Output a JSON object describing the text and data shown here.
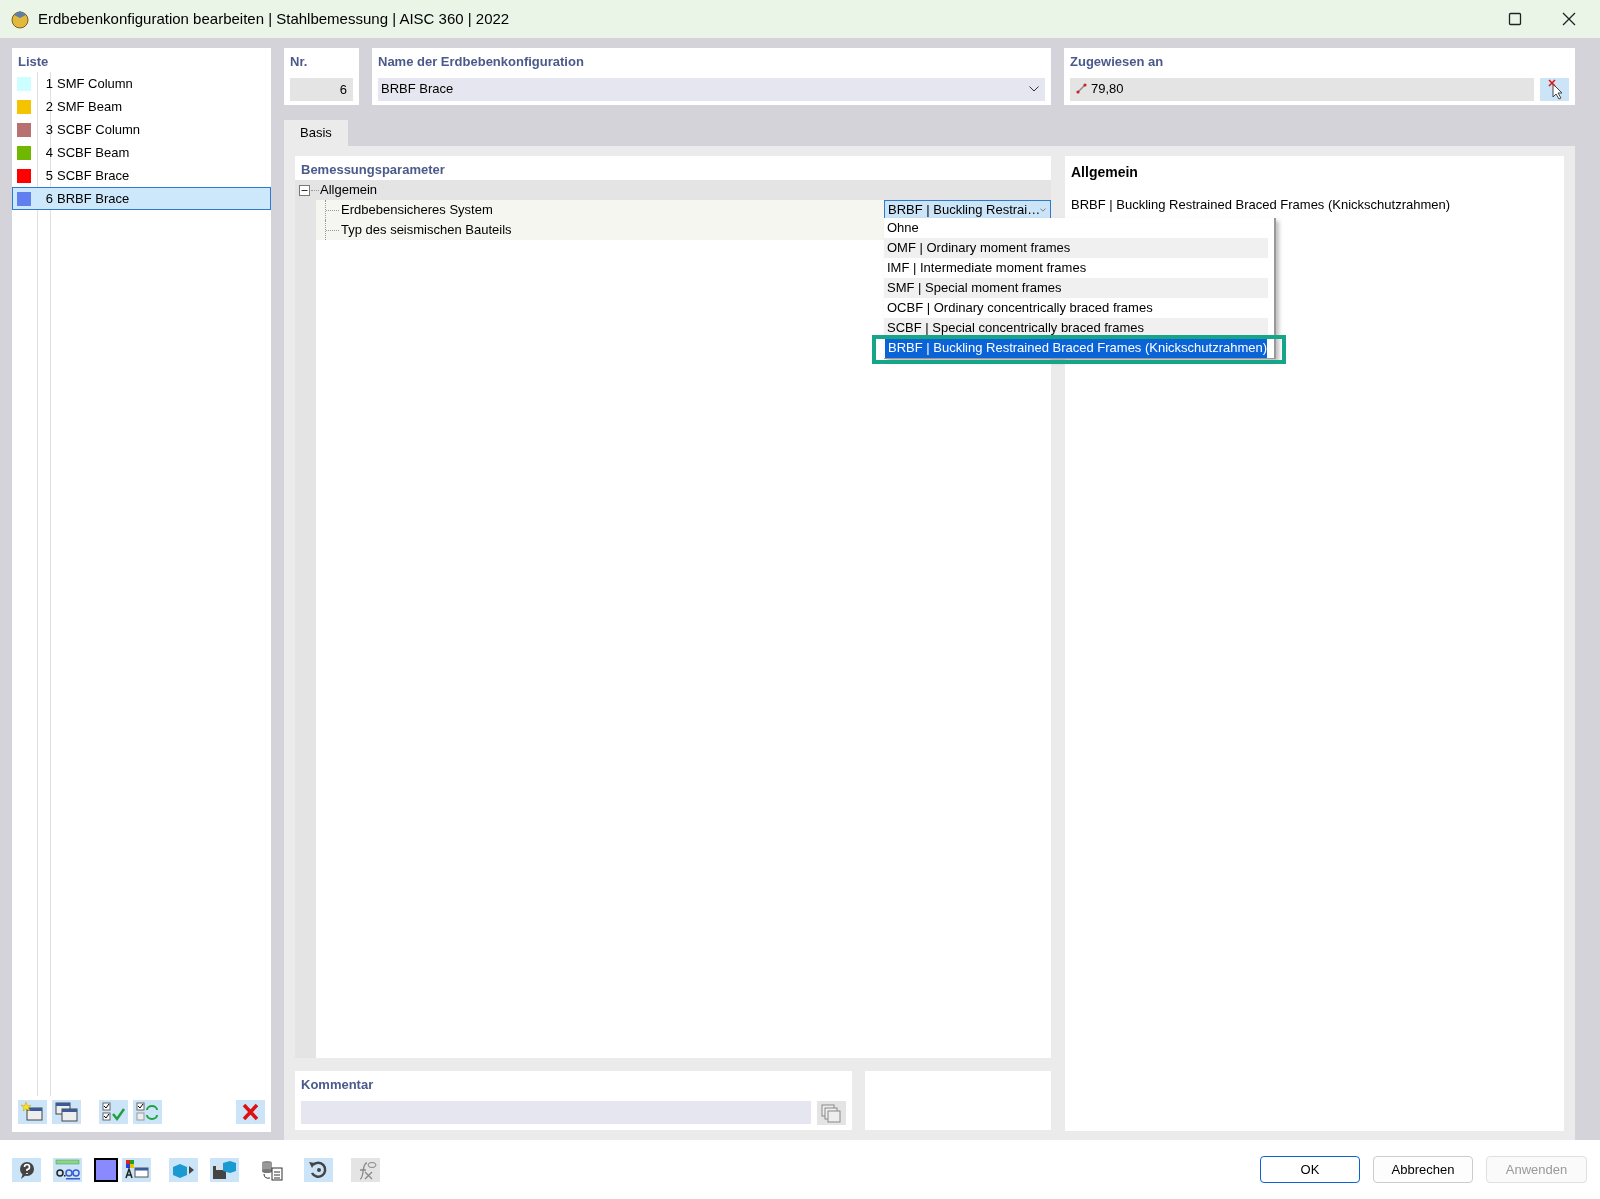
{
  "window": {
    "title": "Erdbebenkonfiguration bearbeiten | Stahlbemessung | AISC 360 | 2022"
  },
  "list": {
    "header": "Liste",
    "items": [
      {
        "number": "1",
        "label": "SMF Column",
        "color": "#ccffff",
        "selected": false
      },
      {
        "number": "2",
        "label": "SMF Beam",
        "color": "#f5c400",
        "selected": false
      },
      {
        "number": "3",
        "label": "SCBF Column",
        "color": "#b87070",
        "selected": false
      },
      {
        "number": "4",
        "label": "SCBF Beam",
        "color": "#70b800",
        "selected": false
      },
      {
        "number": "5",
        "label": "SCBF Brace",
        "color": "#ff0000",
        "selected": false
      },
      {
        "number": "6",
        "label": "BRBF Brace",
        "color": "#6080f0",
        "selected": true
      }
    ]
  },
  "number_field": {
    "label": "Nr.",
    "value": "6"
  },
  "name_field": {
    "label": "Name der Erdbebenkonfiguration",
    "value": "BRBF Brace"
  },
  "assigned": {
    "label": "Zugewiesen an",
    "value": "79,80"
  },
  "tabs": [
    {
      "label": "Basis",
      "selected": true
    }
  ],
  "parameters": {
    "header": "Bemessungsparameter",
    "groups": [
      {
        "label": "Allgemein",
        "expanded": true,
        "children": [
          {
            "label": "Erdbebensicheres System",
            "value": "BRBF | Buckling Restrai…"
          },
          {
            "label": "Typ des seismischen Bauteils"
          }
        ]
      }
    ]
  },
  "dropdown": {
    "options": [
      {
        "label": "Ohne",
        "selected": false
      },
      {
        "label": "OMF | Ordinary moment frames",
        "selected": false
      },
      {
        "label": "IMF | Intermediate moment frames",
        "selected": false
      },
      {
        "label": "SMF | Special moment frames",
        "selected": false
      },
      {
        "label": "OCBF | Ordinary concentrically braced frames",
        "selected": false
      },
      {
        "label": "SCBF | Special concentrically braced frames",
        "selected": false
      },
      {
        "label": "BRBF | Buckling Restrained Braced Frames (Knickschutzrahmen)",
        "selected": true
      }
    ]
  },
  "info": {
    "title": "Allgemein",
    "text": "BRBF | Buckling Restrained Braced Frames (Knickschutzrahmen)"
  },
  "comment": {
    "label": "Kommentar"
  },
  "buttons": [
    {
      "label": "OK",
      "disabled": false
    },
    {
      "label": "Abbrechen",
      "disabled": false
    },
    {
      "label": "Anwenden",
      "disabled": true
    }
  ]
}
